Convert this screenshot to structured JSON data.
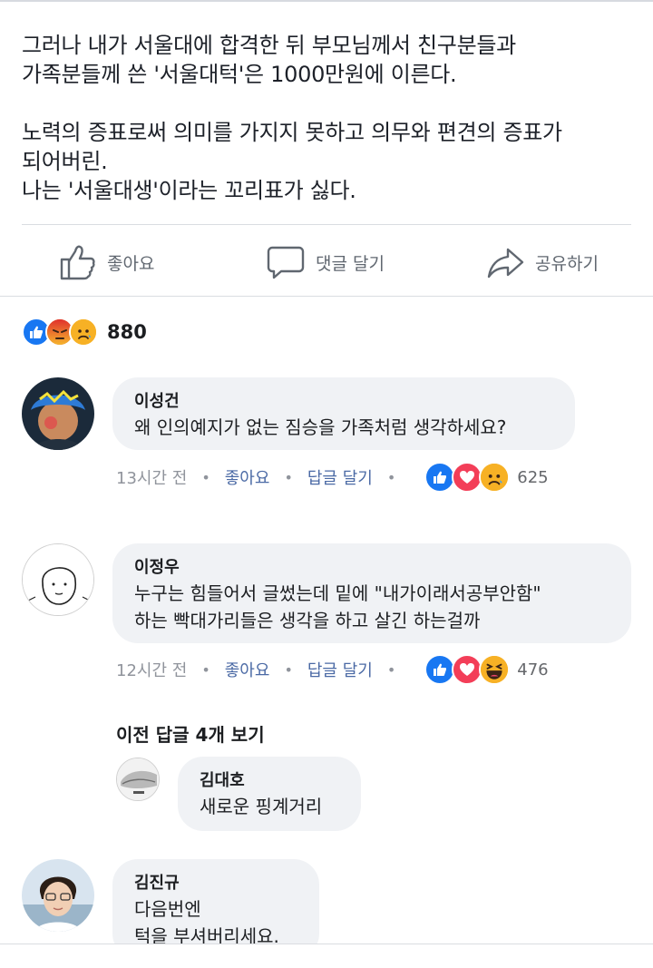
{
  "post": {
    "paragraph1": "그러나 내가 서울대에 합격한 뒤 부모님께서 친구분들과\n가족분들께 쓴 '서울대턱'은 1000만원에 이른다.",
    "paragraph2": "노력의 증표로써 의미를 가지지 못하고 의무와 편견의 증표가\n되어버린.\n나는 '서울대생'이라는 꼬리표가 싫다."
  },
  "actions": {
    "like": "좋아요",
    "comment": "댓글 달기",
    "share": "공유하기"
  },
  "reactions": {
    "icons": [
      "like-icon",
      "angry-icon",
      "sad-icon"
    ],
    "count": "880"
  },
  "comments": [
    {
      "name": "이성건",
      "text": "왜 인의예지가 없는 짐승을 가족처럼 생각하세요?",
      "time": "13시간 전",
      "like": "좋아요",
      "reply": "답글 달기",
      "reactions": [
        "like-icon",
        "love-icon",
        "sad-icon"
      ],
      "count": "625"
    },
    {
      "name": "이정우",
      "text": "누구는 힘들어서 글썼는데 밑에 \"내가이래서공부안함\"\n하는 빡대가리들은 생각을 하고 살긴 하는걸까",
      "time": "12시간 전",
      "like": "좋아요",
      "reply": "답글 달기",
      "reactions": [
        "like-icon",
        "love-icon",
        "haha-icon"
      ],
      "count": "476"
    }
  ],
  "prev_replies": "이전 답글 4개 보기",
  "reply": {
    "name": "김대호",
    "text": "새로운 핑계거리"
  },
  "comment3": {
    "name": "김진규",
    "text": "다음번엔\n턱을 부셔버리세요."
  },
  "colors": {
    "like_blue": "#1877f2",
    "love_red": "#f33e58",
    "emoji_yellow": "#f7b125",
    "angry_orange": "#e9710f",
    "link_blue": "#4b6aa5",
    "bubble_gray": "#f0f2f5"
  }
}
